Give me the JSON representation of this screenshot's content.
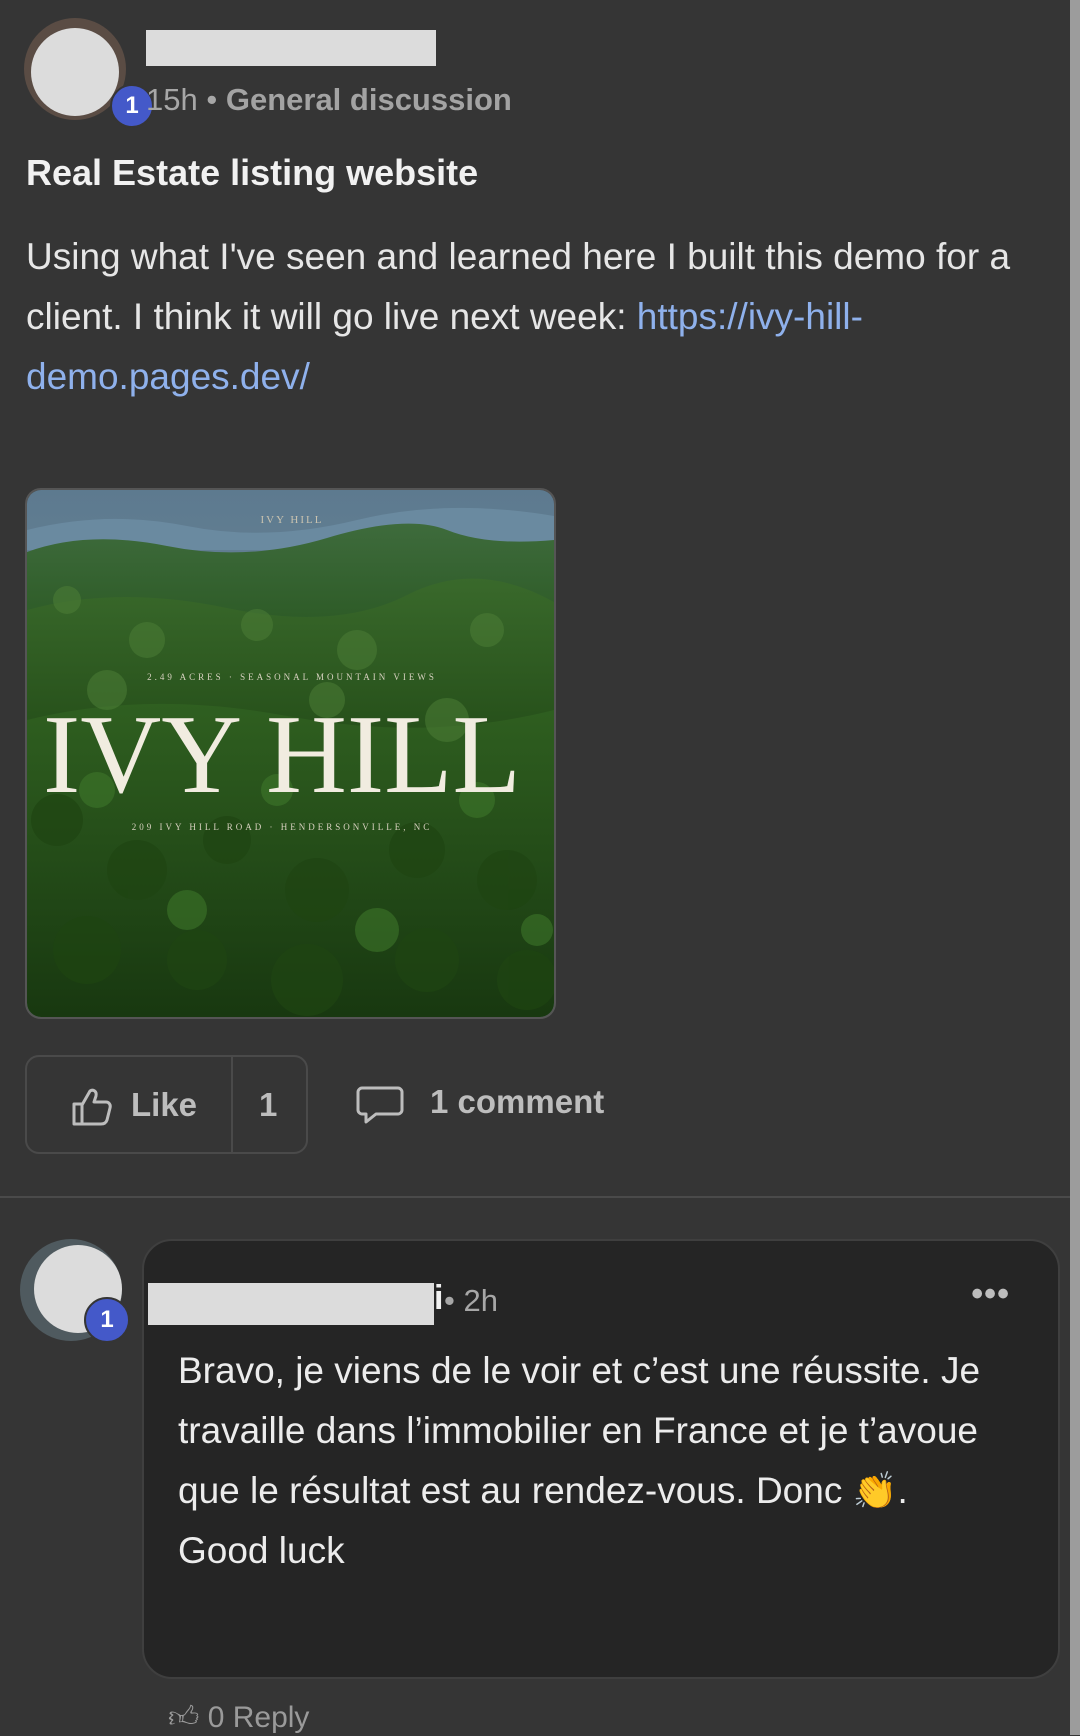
{
  "post": {
    "time": "15h",
    "separator": "•",
    "category": "General discussion",
    "author_level": "1",
    "title": "Real Estate listing website",
    "body_text": "Using what I've seen and learned here I built this demo for a client. I think it will go live next week: ",
    "link_text": "https://ivy-hill-demo.pages.dev/",
    "image": {
      "top_text": "IVY HILL",
      "subtitle": "2.49 ACRES · SEASONAL MOUNTAIN VIEWS",
      "title": "IVY HILL",
      "address": "209 IVY HILL ROAD · HENDERSONVILLE, NC"
    },
    "like_label": "Like",
    "like_count": "1",
    "comment_label": "1 comment"
  },
  "comment": {
    "author_visible": "i",
    "separator": "•",
    "time": "2h",
    "author_level": "1",
    "more_label": "•••",
    "line1": "Bravo, je viens de le voir et c’est une réussite. Je travaille dans l’immobilier en France et je t’avoue que le résultat est au rendez-vous. Donc ",
    "emoji": "👏",
    "line1_end": ".",
    "line2": "Good luck",
    "reply_count": "0",
    "reply_label": "Reply"
  },
  "colors": {
    "background": "#353535",
    "card": "#252525",
    "link": "#8fb1ec",
    "level_badge": "#4459c9"
  },
  "icons": [
    "thumbs-up-icon",
    "comment-icon",
    "more-icon"
  ]
}
